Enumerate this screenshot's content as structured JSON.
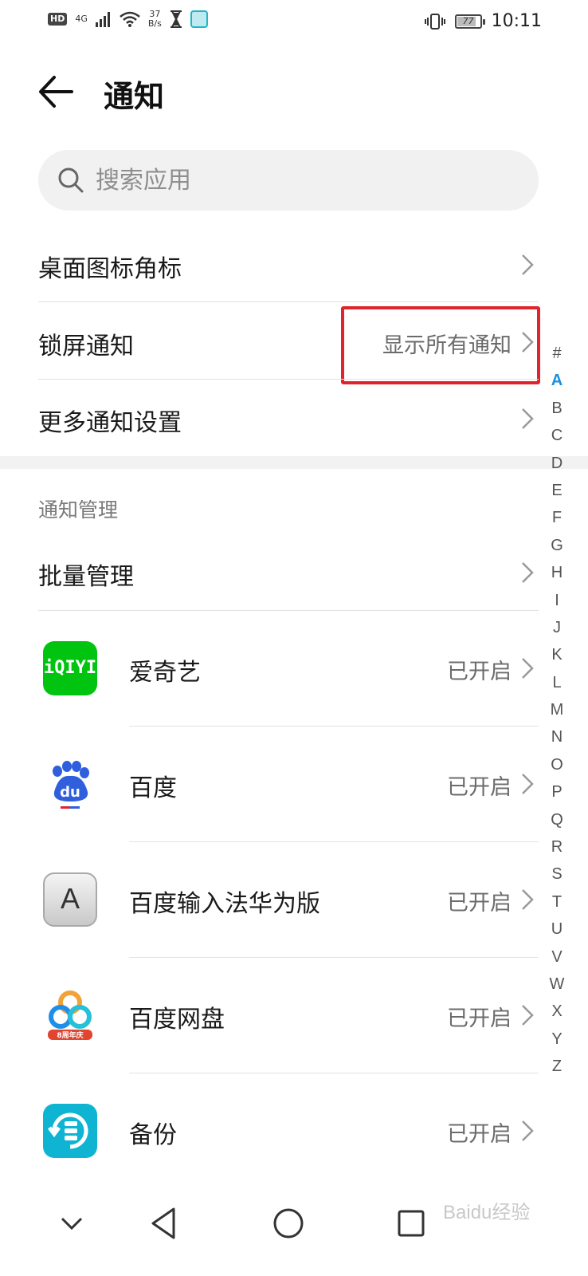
{
  "status_bar": {
    "hd": "HD",
    "network": "4G",
    "speed_value": "37",
    "speed_unit": "B/s",
    "battery": "77",
    "time": "10:11"
  },
  "header": {
    "title": "通知"
  },
  "search": {
    "placeholder": "搜索应用"
  },
  "settings": [
    {
      "label": "桌面图标角标",
      "value": ""
    },
    {
      "label": "锁屏通知",
      "value": "显示所有通知"
    },
    {
      "label": "更多通知设置",
      "value": ""
    }
  ],
  "section": {
    "title": "通知管理"
  },
  "batch": {
    "label": "批量管理"
  },
  "apps": [
    {
      "name": "爱奇艺",
      "status": "已开启",
      "icon": "iqiyi-icon",
      "icon_text": "iQIYI"
    },
    {
      "name": "百度",
      "status": "已开启",
      "icon": "baidu-icon",
      "icon_text": "du"
    },
    {
      "name": "百度输入法华为版",
      "status": "已开启",
      "icon": "baidu-input-icon",
      "icon_text": "A"
    },
    {
      "name": "百度网盘",
      "status": "已开启",
      "icon": "baidu-pan-icon",
      "icon_text": "8周年庆"
    },
    {
      "name": "备份",
      "status": "已开启",
      "icon": "backup-icon",
      "icon_text": ""
    }
  ],
  "alphabet": [
    "#",
    "A",
    "B",
    "C",
    "D",
    "E",
    "F",
    "G",
    "H",
    "I",
    "J",
    "K",
    "L",
    "M",
    "N",
    "O",
    "P",
    "Q",
    "R",
    "S",
    "T",
    "U",
    "V",
    "W",
    "X",
    "Y",
    "Z"
  ],
  "alphabet_active": "A",
  "colors": {
    "highlight": "#e0232f",
    "accent": "#1a8fe0",
    "iqiyi": "#00c40f",
    "backup": "#0fb4d3"
  },
  "watermark": "Baidu经验"
}
